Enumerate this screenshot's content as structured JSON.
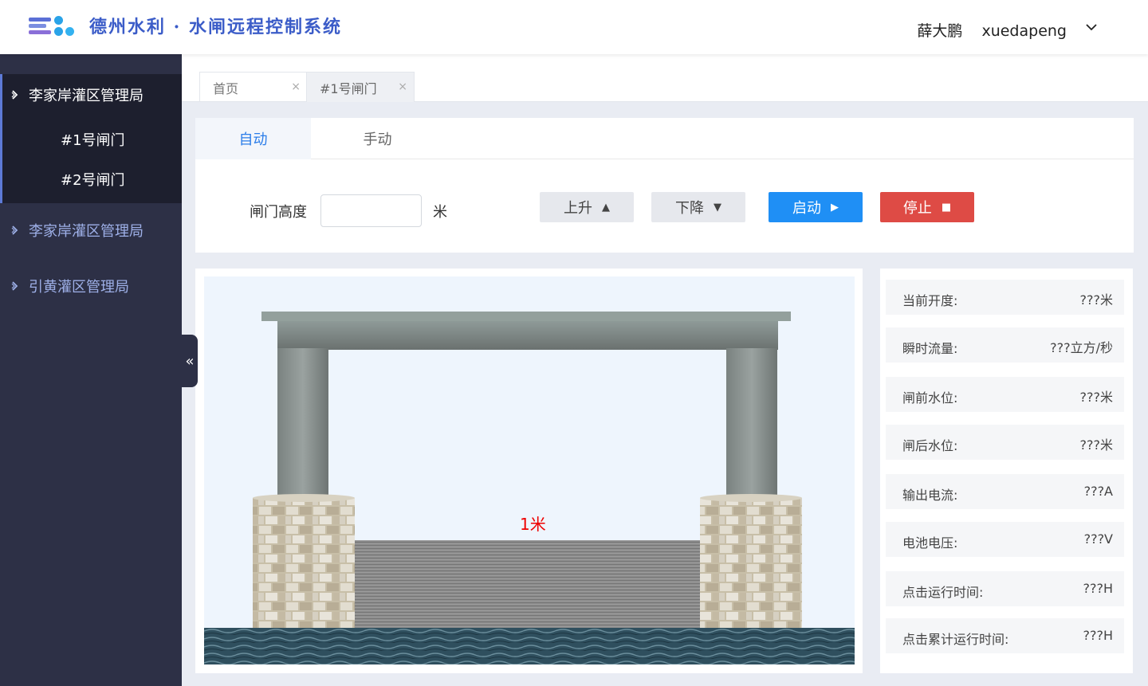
{
  "header": {
    "title": "德州水利 · 水闸远程控制系统",
    "user_display_name": "薛大鹏",
    "username": "xuedapeng"
  },
  "colors": {
    "brand": "#3b5cc8",
    "sidebar_bg": "#2d3046",
    "primary_button": "#1f8ff5",
    "stop_button": "#de4b45",
    "gate_height_text": "#e00000"
  },
  "sidebar": {
    "groups": [
      {
        "label": "李家岸灌区管理局",
        "expanded": true,
        "items": [
          {
            "label": "#1号闸门"
          },
          {
            "label": "#2号闸门"
          }
        ]
      },
      {
        "label": "李家岸灌区管理局",
        "expanded": false
      },
      {
        "label": "引黄灌区管理局",
        "expanded": false
      }
    ],
    "collapse_glyph": "«"
  },
  "tabs": [
    {
      "label": "首页",
      "close": "×",
      "active": false
    },
    {
      "label": "#1号闸门",
      "close": "×",
      "active": true
    }
  ],
  "control": {
    "modes": [
      {
        "label": "自动",
        "active": true
      },
      {
        "label": "手动",
        "active": false
      }
    ],
    "height_label": "闸门高度",
    "height_value": "",
    "height_unit": "米",
    "buttons": {
      "up": {
        "label": "上升",
        "icon": "▲"
      },
      "down": {
        "label": "下降",
        "icon": "▼"
      },
      "start": {
        "label": "启动",
        "icon": "▶"
      },
      "stop": {
        "label": "停止",
        "icon": "■"
      }
    }
  },
  "visual": {
    "gate_height_text": "1米"
  },
  "info": [
    {
      "label": "当前开度:",
      "value": "???米"
    },
    {
      "label": "瞬时流量:",
      "value": "???立方/秒"
    },
    {
      "label": "闸前水位:",
      "value": "???米"
    },
    {
      "label": "闸后水位:",
      "value": "???米"
    },
    {
      "label": "输出电流:",
      "value": "???A"
    },
    {
      "label": "电池电压:",
      "value": "???V"
    },
    {
      "label": "点击运行时间:",
      "value": "???H"
    },
    {
      "label": "点击累计运行时间:",
      "value": "???H"
    }
  ]
}
